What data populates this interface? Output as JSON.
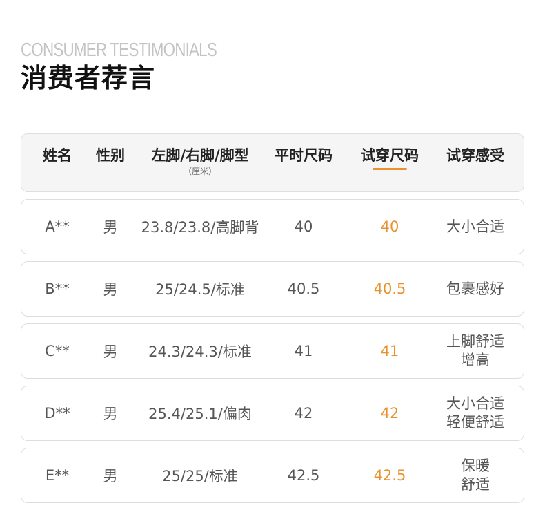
{
  "section": {
    "eyebrow": "CONSUMER TESTIMONIALS",
    "title": "消费者荐言"
  },
  "table": {
    "headers": {
      "name": "姓名",
      "gender": "性别",
      "feet": "左脚/右脚/脚型",
      "feet_unit": "（厘米）",
      "usual_size": "平时尺码",
      "trial_size": "试穿尺码",
      "feeling": "试穿感受"
    },
    "accent_color": "#e8912d",
    "rows": [
      {
        "name": "A**",
        "gender": "男",
        "feet": "23.8/23.8/高脚背",
        "usual": "40",
        "trial": "40",
        "feeling_1": "大小合适",
        "feeling_2": ""
      },
      {
        "name": "B**",
        "gender": "男",
        "feet": "25/24.5/标准",
        "usual": "40.5",
        "trial": "40.5",
        "feeling_1": "包裹感好",
        "feeling_2": ""
      },
      {
        "name": "C**",
        "gender": "男",
        "feet": "24.3/24.3/标准",
        "usual": "41",
        "trial": "41",
        "feeling_1": "上脚舒适",
        "feeling_2": "增高"
      },
      {
        "name": "D**",
        "gender": "男",
        "feet": "25.4/25.1/偏肉",
        "usual": "42",
        "trial": "42",
        "feeling_1": "大小合适",
        "feeling_2": "轻便舒适"
      },
      {
        "name": "E**",
        "gender": "男",
        "feet": "25/25/标准",
        "usual": "42.5",
        "trial": "42.5",
        "feeling_1": "保暖",
        "feeling_2": "舒适"
      }
    ]
  }
}
